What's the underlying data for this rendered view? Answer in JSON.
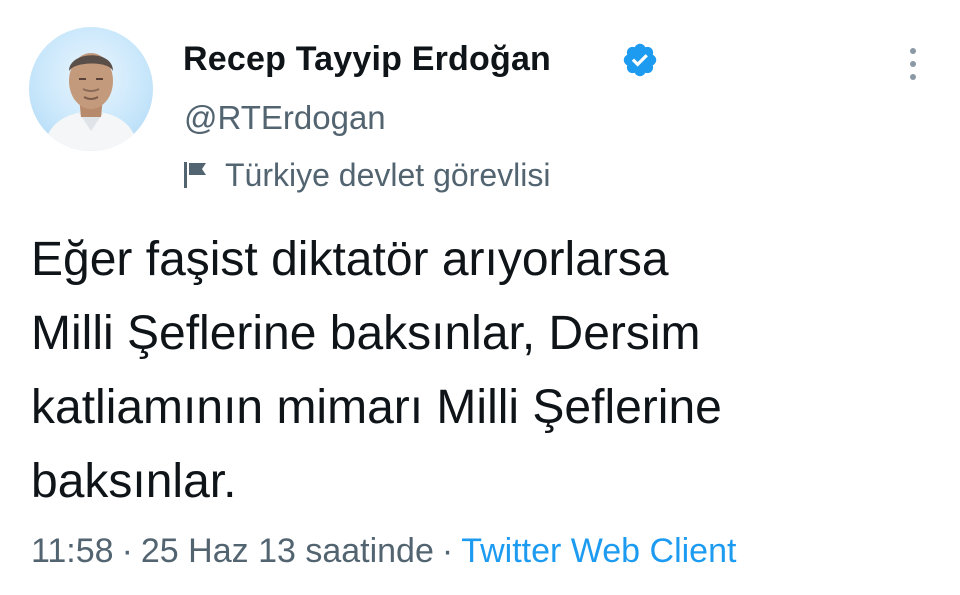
{
  "author": {
    "display_name": "Recep Tayyip Erdoğan",
    "handle": "@RTErdogan",
    "verified": true,
    "account_label": "Türkiye devlet görevlisi",
    "avatar_icon": "profile-photo",
    "verified_icon": "verified-badge-icon",
    "label_icon": "flag-icon"
  },
  "tweet": {
    "lines": [
      "Eğer faşist diktatör arıyorlarsa",
      "Milli Şeflerine baksınlar, Dersim",
      "katliamının mimarı Milli Şeflerine",
      "baksınlar."
    ]
  },
  "meta": {
    "time": "11:58",
    "separator": "·",
    "date": "25 Haz 13 saatinde",
    "source": "Twitter Web Client"
  },
  "colors": {
    "text": "#0f1419",
    "secondary": "#536471",
    "accent": "#1d9bf0"
  },
  "more_icon": "more-options-icon"
}
